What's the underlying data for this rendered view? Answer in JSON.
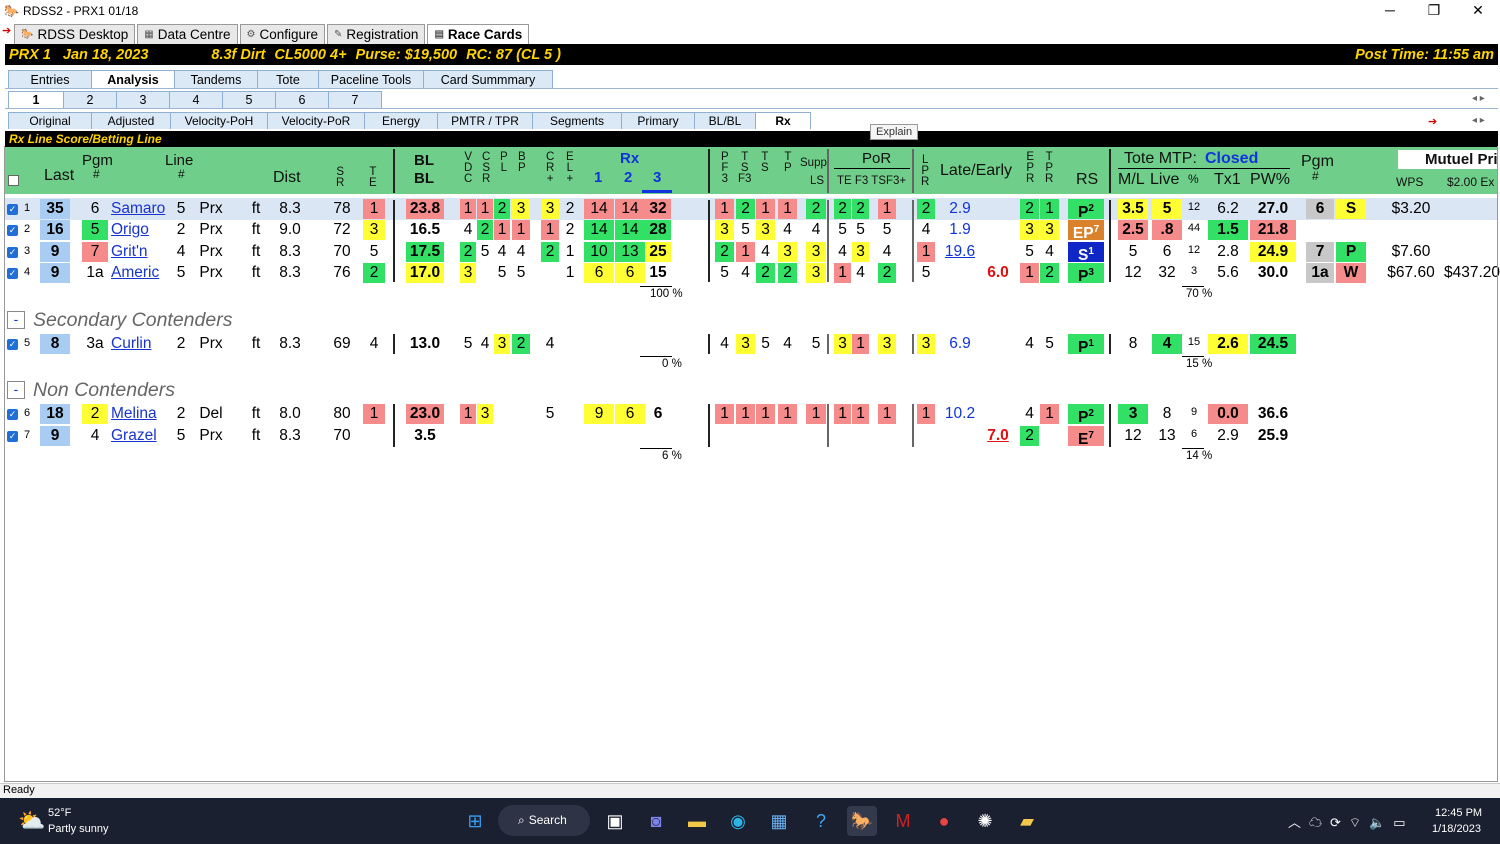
{
  "window": {
    "title": "RDSS2 - PRX1 01/18",
    "min": "─",
    "max": "❐",
    "close": "✕"
  },
  "main_tabs": [
    {
      "label": "RDSS Desktop"
    },
    {
      "label": "Data Centre"
    },
    {
      "label": "Configure"
    },
    {
      "label": "Registration"
    },
    {
      "label": "Race Cards"
    }
  ],
  "race_info": {
    "track": "PRX 1",
    "date": "Jan 18, 2023",
    "surface": "8.3f Dirt",
    "class": "CL5000 4+",
    "purse": "Purse: $19,500",
    "rc": "RC: 87 (CL 5 )",
    "post_time": "Post Time: 11:55 am"
  },
  "analysis_tabs": [
    "Entries",
    "Analysis",
    "Tandems",
    "Tote",
    "Paceline Tools",
    "Card Summmary"
  ],
  "race_tabs": [
    "1",
    "2",
    "3",
    "4",
    "5",
    "6",
    "7"
  ],
  "view_tabs": [
    "Original",
    "Adjusted",
    "Velocity-PoH",
    "Velocity-PoR",
    "Energy",
    "PMTR / TPR",
    "Segments",
    "Primary",
    "BL/BL",
    "Rx"
  ],
  "nav_arrows": "◂ ▸",
  "explain": "Explain",
  "score_title": "Rx Line Score/Betting Line",
  "headers": {
    "last": "Last",
    "pgm": "Pgm",
    "pgm_hash": "#",
    "line": "Line",
    "line_hash": "#",
    "dist": "Dist",
    "sr": "S\nR",
    "te": "T\nE",
    "bl1": "BL",
    "bl2": "BL",
    "vdc": "V\nD\nC",
    "csr": "C\nS\nR",
    "pl": "P\nL",
    "bp": "B\nP",
    "cr": "C\nR\n+",
    "el": "E\nL\n+",
    "rx": "Rx",
    "rx1": "1",
    "rx2": "2",
    "rx3": "3",
    "pf3": "P\nF\n3",
    "tsf3": "T\nS\nF3",
    "ts": "T\nS",
    "tp": "T\nP",
    "supp": "Supp.",
    "ls": "LS",
    "por": "PoR",
    "te_f3": "TE F3 TSF3+",
    "lpr": "L\nP\nR",
    "late_early": "Late/Early",
    "epr": "E\nP\nR",
    "tpr": "T\nP\nR",
    "rs": "RS",
    "tote": "Tote MTP:",
    "tote_status": "Closed",
    "ml": "M/L",
    "live": "Live",
    "pcts": "%",
    "tx1": "Tx1",
    "pw": "PW%",
    "pgm2": "Pgm",
    "pgm2_hash": "#",
    "mutuel": "Mutuel Pri",
    "wps": "WPS",
    "ex": "$2.00 Ex"
  },
  "rows": [
    {
      "n": "1",
      "last": "35",
      "pgm": "6",
      "name": "Samaro",
      "line": "5",
      "trk": "Prx",
      "sf": "ft",
      "dist": "8.3",
      "sr": "78",
      "te": "1",
      "bl": "23.8",
      "vdc": "1",
      "csr": "1",
      "pl": "2",
      "bp": "3",
      "cr": "3",
      "el": "2",
      "rx1": "14",
      "rx2": "14",
      "rx3": "32",
      "pf3": "1",
      "tsf3": "2",
      "ts": "1",
      "tp": "1",
      "ls": "2",
      "te2": "2",
      "f3": "2",
      "tsf": "1",
      "lpr": "2",
      "late": "2.9",
      "early": "",
      "epr": "2",
      "tpr": "1",
      "rs": "P",
      "rsn": "2",
      "ml": "3.5",
      "live": "5",
      "pct": "12",
      "tx1": "6.2",
      "pw": "27.0",
      "pgm2": "6",
      "wps": "S",
      "mut": "$3.20",
      "ex": ""
    },
    {
      "n": "2",
      "last": "16",
      "pgm": "5",
      "name": "Origo",
      "line": "2",
      "trk": "Prx",
      "sf": "ft",
      "dist": "9.0",
      "sr": "72",
      "te": "3",
      "bl": "16.5",
      "vdc": "4",
      "csr": "2",
      "pl": "1",
      "bp": "1",
      "cr": "1",
      "el": "2",
      "rx1": "14",
      "rx2": "14",
      "rx3": "28",
      "pf3": "3",
      "tsf3": "5",
      "ts": "3",
      "tp": "4",
      "ls": "4",
      "te2": "5",
      "f3": "5",
      "tsf": "5",
      "lpr": "4",
      "late": "1.9",
      "early": "",
      "epr": "3",
      "tpr": "3",
      "rs": "EP",
      "rsn": "7",
      "ml": "2.5",
      "live": ".8",
      "pct": "44",
      "tx1": "1.5",
      "pw": "21.8",
      "pgm2": "",
      "wps": "",
      "mut": "",
      "ex": ""
    },
    {
      "n": "3",
      "last": "9",
      "pgm": "7",
      "name": "Grit'n",
      "line": "4",
      "trk": "Prx",
      "sf": "ft",
      "dist": "8.3",
      "sr": "70",
      "te": "5",
      "bl": "17.5",
      "vdc": "2",
      "csr": "5",
      "pl": "4",
      "bp": "4",
      "cr": "2",
      "el": "1",
      "rx1": "10",
      "rx2": "13",
      "rx3": "25",
      "pf3": "2",
      "tsf3": "1",
      "ts": "4",
      "tp": "3",
      "ls": "3",
      "te2": "4",
      "f3": "3",
      "tsf": "4",
      "lpr": "1",
      "late": "19.6",
      "early": "",
      "epr": "5",
      "tpr": "4",
      "rs": "S",
      "rsn": "1",
      "ml": "5",
      "live": "6",
      "pct": "12",
      "tx1": "2.8",
      "pw": "24.9",
      "pgm2": "7",
      "wps": "P",
      "mut": "$7.60",
      "ex": ""
    },
    {
      "n": "4",
      "last": "9",
      "pgm": "1a",
      "name": "Americ",
      "line": "5",
      "trk": "Prx",
      "sf": "ft",
      "dist": "8.3",
      "sr": "76",
      "te": "2",
      "bl": "17.0",
      "vdc": "3",
      "csr": "",
      "pl": "5",
      "bp": "5",
      "cr": "",
      "el": "1",
      "rx1": "6",
      "rx2": "6",
      "rx3": "15",
      "pf3": "5",
      "tsf3": "4",
      "ts": "2",
      "tp": "2",
      "ls": "3",
      "te2": "1",
      "f3": "4",
      "tsf": "2",
      "lpr": "5",
      "late": "",
      "early": "6.0",
      "epr": "1",
      "tpr": "2",
      "rs": "P",
      "rsn": "3",
      "ml": "12",
      "live": "32",
      "pct": "3",
      "tx1": "5.6",
      "pw": "30.0",
      "pgm2": "1a",
      "wps": "W",
      "mut": "$67.60",
      "ex": "$437.20"
    },
    {
      "n": "5",
      "last": "8",
      "pgm": "3a",
      "name": "Curlin",
      "line": "2",
      "trk": "Prx",
      "sf": "ft",
      "dist": "8.3",
      "sr": "69",
      "te": "4",
      "bl": "13.0",
      "vdc": "5",
      "csr": "4",
      "pl": "3",
      "bp": "2",
      "cr": "4",
      "el": "",
      "rx1": "",
      "rx2": "",
      "rx3": "",
      "pf3": "4",
      "tsf3": "3",
      "ts": "5",
      "tp": "4",
      "ls": "5",
      "te2": "3",
      "f3": "1",
      "tsf": "3",
      "lpr": "3",
      "late": "6.9",
      "early": "",
      "epr": "4",
      "tpr": "5",
      "rs": "P",
      "rsn": "1",
      "ml": "8",
      "live": "4",
      "pct": "15",
      "tx1": "2.6",
      "pw": "24.5",
      "pgm2": "",
      "wps": "",
      "mut": "",
      "ex": ""
    },
    {
      "n": "6",
      "last": "18",
      "pgm": "2",
      "name": "Melina",
      "line": "2",
      "trk": "Del",
      "sf": "ft",
      "dist": "8.0",
      "sr": "80",
      "te": "1",
      "bl": "23.0",
      "vdc": "1",
      "csr": "3",
      "pl": "",
      "bp": "",
      "cr": "5",
      "el": "",
      "rx1": "9",
      "rx2": "6",
      "rx3": "6",
      "pf3": "1",
      "tsf3": "1",
      "ts": "1",
      "tp": "1",
      "ls": "1",
      "te2": "1",
      "f3": "1",
      "tsf": "1",
      "lpr": "1",
      "late": "10.2",
      "early": "",
      "epr": "4",
      "tpr": "1",
      "rs": "P",
      "rsn": "2",
      "ml": "3",
      "live": "8",
      "pct": "9",
      "tx1": "0.0",
      "pw": "36.6",
      "pgm2": "",
      "wps": "",
      "mut": "",
      "ex": ""
    },
    {
      "n": "7",
      "last": "9",
      "pgm": "4",
      "name": "Grazel",
      "line": "5",
      "trk": "Prx",
      "sf": "ft",
      "dist": "8.3",
      "sr": "70",
      "te": "",
      "bl": "3.5",
      "vdc": "",
      "csr": "",
      "pl": "",
      "bp": "",
      "cr": "",
      "el": "",
      "rx1": "",
      "rx2": "",
      "rx3": "",
      "pf3": "",
      "tsf3": "",
      "ts": "",
      "tp": "",
      "ls": "",
      "te2": "",
      "f3": "",
      "tsf": "",
      "lpr": "",
      "late": "",
      "early": "7.0",
      "epr": "2",
      "tpr": "",
      "rs": "E",
      "rsn": "7",
      "ml": "12",
      "live": "13",
      "pct": "6",
      "tx1": "2.9",
      "pw": "25.9",
      "pgm2": "",
      "wps": "",
      "mut": "",
      "ex": ""
    }
  ],
  "sections": {
    "secondary": "Secondary Contenders",
    "non": "Non Contenders",
    "collapse": "-"
  },
  "pcts": {
    "rx_main": "100 %",
    "tote_main": "70 %",
    "rx_sec": "0 %",
    "tote_sec": "15 %",
    "rx_non": "6 %",
    "tote_non": "14 %"
  },
  "status": "Ready",
  "taskbar": {
    "temp": "52°F",
    "weather": "Partly sunny",
    "search": "Search",
    "time": "12:45 PM",
    "date": "1/18/2023"
  }
}
